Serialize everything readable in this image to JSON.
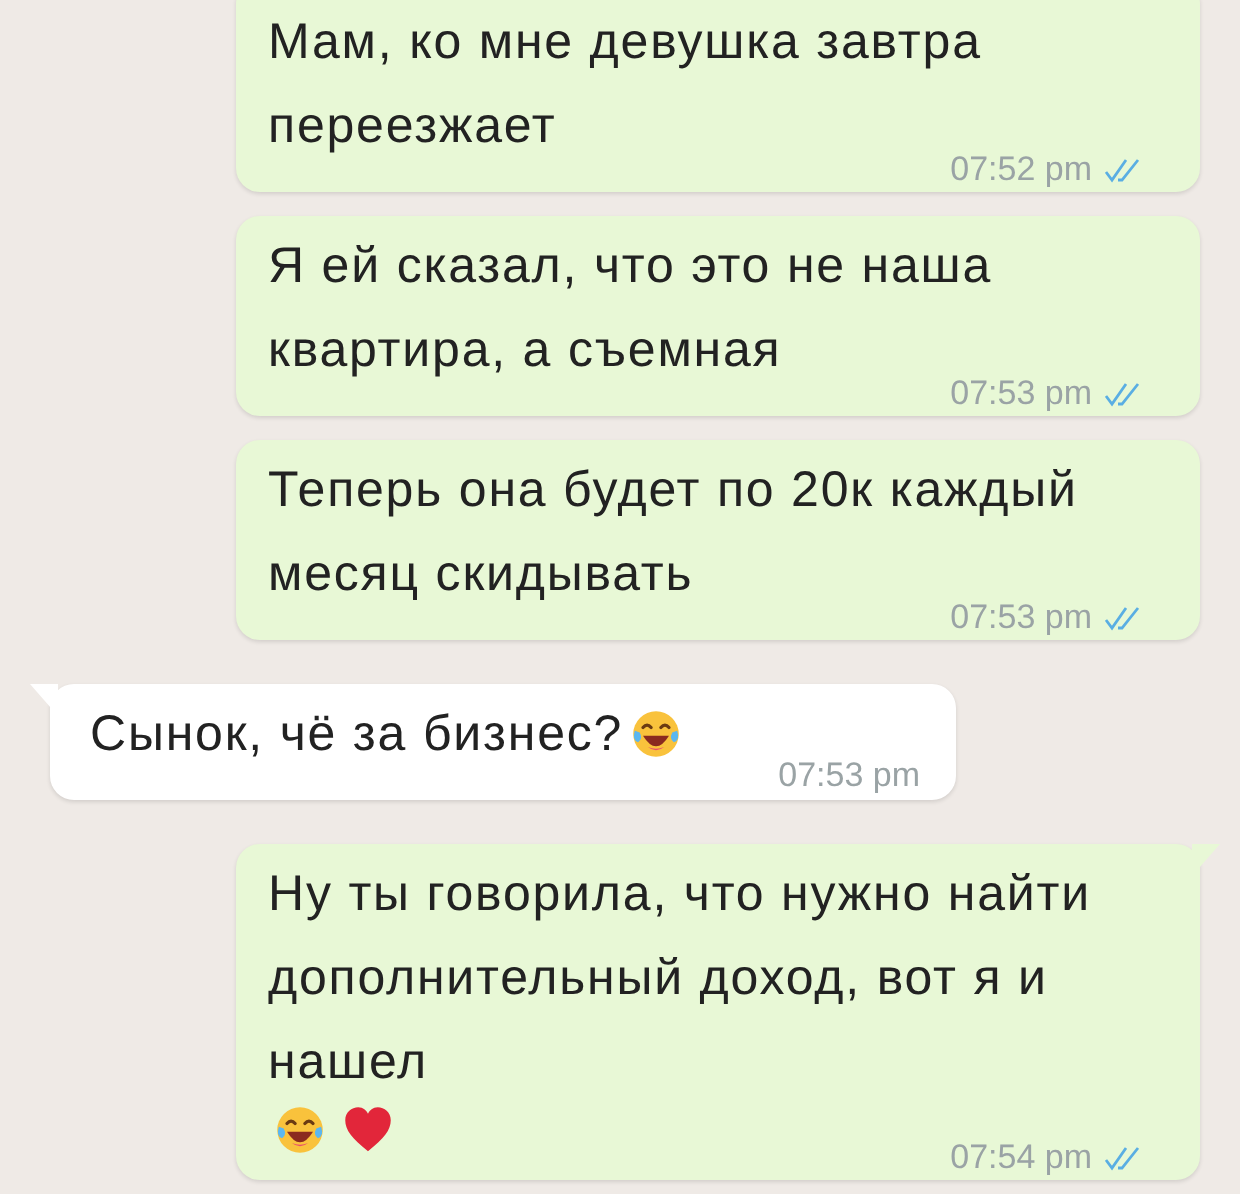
{
  "messages": [
    {
      "kind": "outgoing",
      "tail": false,
      "text": "Мам, ко мне девушка завтра переезжает",
      "time": "07:52 pm",
      "read": true
    },
    {
      "kind": "outgoing",
      "tail": false,
      "text": "Я ей сказал, что это не наша квартира, а съемная",
      "time": "07:53 pm",
      "read": true
    },
    {
      "kind": "outgoing",
      "tail": false,
      "text": "Теперь она будет по 20к каждый месяц скидывать",
      "time": "07:53 pm",
      "read": true
    },
    {
      "kind": "incoming",
      "tail": true,
      "text": "Сынок, чё за бизнес?",
      "emojis": [
        {
          "kind": "laughing"
        }
      ],
      "time": "07:53 pm",
      "read": false
    },
    {
      "kind": "outgoing",
      "tail": true,
      "text": "Ну ты говорила, что нужно найти дополнительный доход, вот я и нашел",
      "emojis": [
        {
          "kind": "laughing"
        },
        {
          "kind": "heart"
        }
      ],
      "time": "07:54 pm",
      "read": true
    }
  ]
}
